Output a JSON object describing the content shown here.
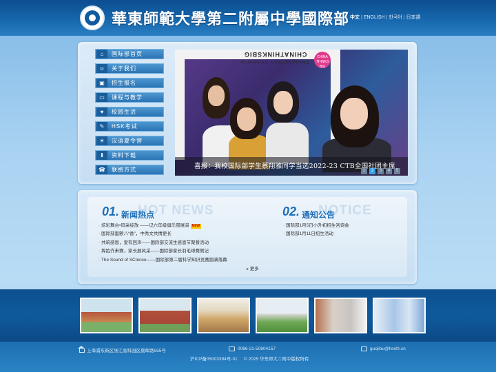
{
  "header": {
    "school_name": "華東師範大學第二附屬中學國際部",
    "languages": [
      {
        "label": "中文",
        "active": true
      },
      {
        "label": "ENGLISH",
        "active": false
      },
      {
        "label": "한국어",
        "active": false
      },
      {
        "label": "日本語",
        "active": false
      }
    ]
  },
  "menu": {
    "items": [
      {
        "label": "国际部首页",
        "icon": "home-icon"
      },
      {
        "label": "关于我们",
        "icon": "people-icon"
      },
      {
        "label": "招生报名",
        "icon": "form-icon"
      },
      {
        "label": "课程与教学",
        "icon": "chat-icon"
      },
      {
        "label": "校园生活",
        "icon": "heart-icon"
      },
      {
        "label": "HSK考试",
        "icon": "edit-icon"
      },
      {
        "label": "汉语夏令营",
        "icon": "sun-icon"
      },
      {
        "label": "资料下载",
        "icon": "download-icon"
      },
      {
        "label": "联络方式",
        "icon": "phone-icon"
      }
    ]
  },
  "banner": {
    "frame_text": "CHINATHINKSBIG",
    "frame_subtext": "ShanghaiTech University",
    "badge_text": "CHINA THINKS BIG",
    "caption": "喜报：我校国际部学生蔡翔雅同学当选2022-23 CTB全国社团主席",
    "pager": [
      "1",
      "2",
      "3",
      "4",
      "5"
    ],
    "active_page": "2"
  },
  "news": {
    "num": "01.",
    "title": "新闻热点",
    "ghost": "HOT NEWS",
    "items": [
      "炫彩舞台•风采绽放 ——记六年级俱乐部展演",
      "国际部里颤八“香”，中秀文共情更长",
      "共筑感恩，爱有回声——国际部交流生感恩节聚餐活动",
      "挥拍齐来赛，家长展风采——国际部家长羽毛球赛侧记",
      "The Sound of SCIence——国际部第二届科学知识竞赛圆满落幕"
    ],
    "new_tag": "NEW",
    "more": "更多"
  },
  "notice": {
    "num": "02.",
    "title": "通知公告",
    "ghost": "NOTICE",
    "items": [
      "国际部1月5日小升初招生咨询会",
      "国际部1月11日招生活动"
    ]
  },
  "footer": {
    "address": "上海浦东新区张江高科园区晨晖路555号",
    "phone": "0086-21-50804157",
    "email": "guojibu@hsefz.cn",
    "icp": "沪ICP备05003394号-31",
    "copyright": "© 2025   华东师大二附中版权所有"
  }
}
